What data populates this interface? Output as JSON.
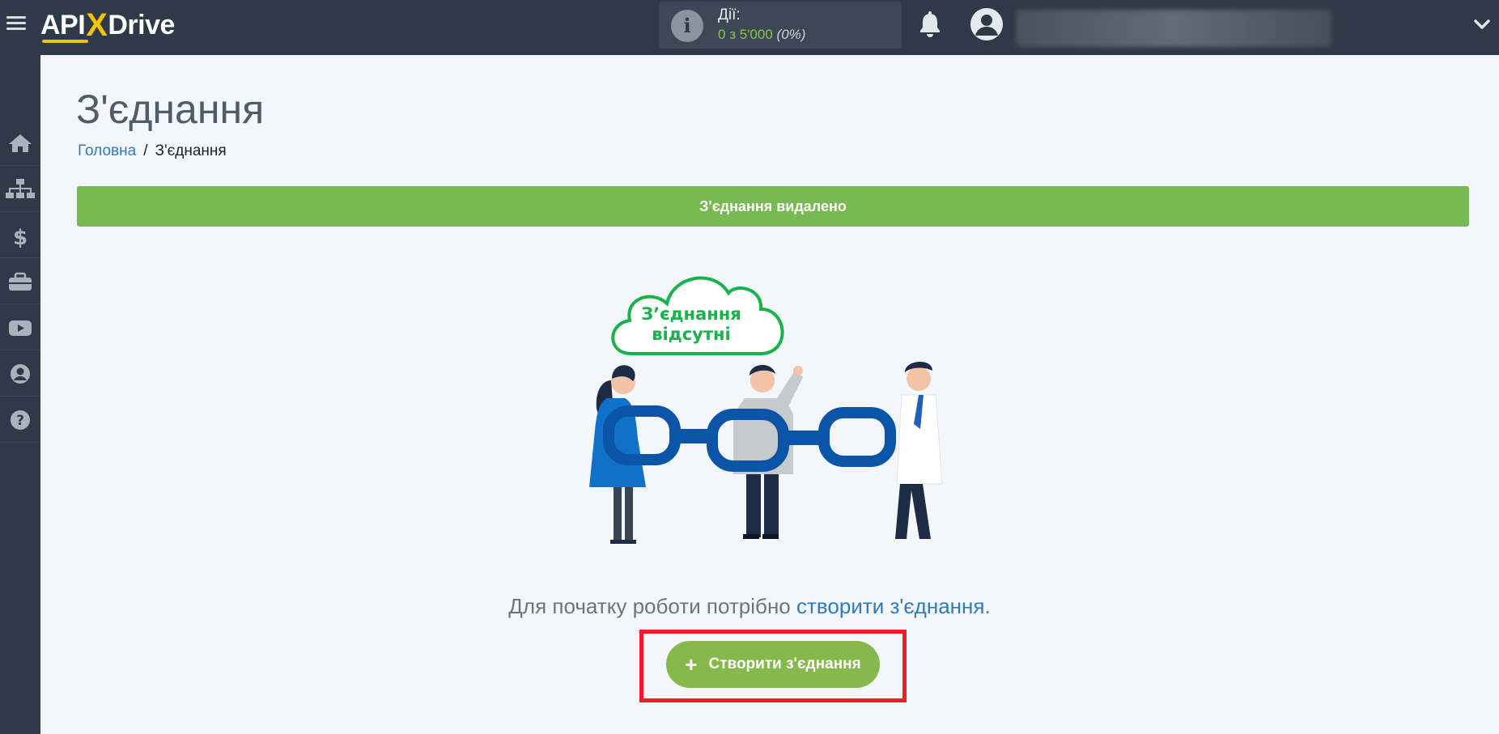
{
  "app": {
    "logo_part_api": "API",
    "logo_part_x": "X",
    "logo_part_drive": "Drive"
  },
  "topbar": {
    "actions_label": "Дії:",
    "actions_used": "0",
    "actions_sep": "з",
    "actions_limit": "5'000",
    "actions_percent": "(0%)",
    "icons": [
      "menu-icon",
      "info-icon",
      "bell-icon",
      "user-avatar-icon",
      "chevron-down-icon"
    ]
  },
  "sidebar": {
    "items": [
      {
        "icon": "home-icon"
      },
      {
        "icon": "sitemap-icon"
      },
      {
        "icon": "dollar-icon"
      },
      {
        "icon": "briefcase-icon"
      },
      {
        "icon": "youtube-icon"
      },
      {
        "icon": "user-circle-icon"
      },
      {
        "icon": "help-icon"
      }
    ]
  },
  "main": {
    "title": "З'єднання",
    "breadcrumb": {
      "home": "Головна",
      "separator": "/",
      "current": "З'єднання"
    },
    "alert": "З'єднання видалено",
    "illustration_text_line1": "З’єднання",
    "illustration_text_line2": "відсутні",
    "helper_text": "Для початку роботи потрібно ",
    "helper_link": "створити з'єднання",
    "helper_end": ".",
    "create_button": "Створити з'єднання",
    "create_button_icon": "+"
  },
  "colors": {
    "topbar": "#2e3a47",
    "success": "#78b954",
    "button": "#86b84c",
    "link": "#2f7bbf",
    "highlight": "#ee1c25",
    "accent": "#f5c400"
  }
}
